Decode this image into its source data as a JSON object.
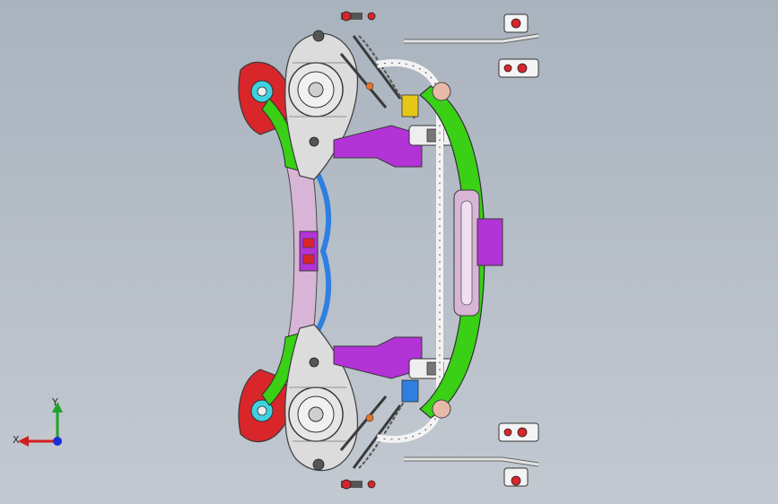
{
  "viewport": {
    "background_top": "#a9b3be",
    "background_bottom": "#c3c9d1"
  },
  "triad": {
    "x_label": "X",
    "y_label": "Y",
    "x_axis_color": "#d11f1f",
    "y_axis_color": "#1fa32a",
    "z_axis_color": "#1a2fd6"
  },
  "model": {
    "description_icon": "suspension-subframe-assembly-icon",
    "colors": {
      "frame": "#dcdcdc",
      "frame_outline": "#4a4a4a",
      "green_bracket": "#39d016",
      "purple_mount": "#b233d6",
      "pink_crossmember": "#d8b5d6",
      "red_mount": "#d8262b",
      "cyan_bushing": "#3fd1df",
      "blue_part": "#2f7fe0",
      "yellow_part": "#e6c619",
      "orange_part": "#e4752a"
    }
  }
}
